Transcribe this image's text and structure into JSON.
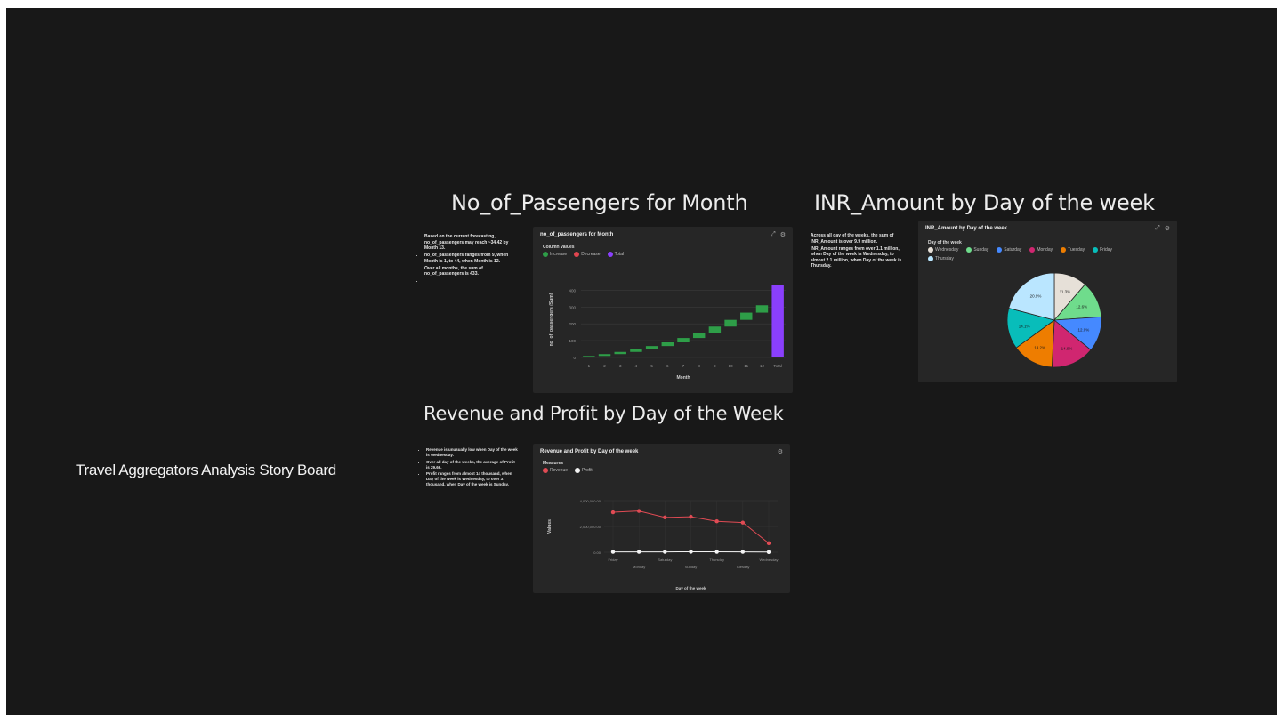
{
  "story": {
    "title": "Travel Aggregators Analysis Story Board"
  },
  "sections": {
    "passengers_title": "No_of_Passengers for Month",
    "inr_title": "INR_Amount by Day of the week",
    "revenue_title": "Revenue and Profit by Day of the Week"
  },
  "passengers_notes": [
    "Based on the current forecasting, no_of_passengers may reach ~34.42 by Month 13.",
    "no_of_passengers ranges from 9, when Month is 1, to 44, when Month is 12.",
    "Over all months, the sum of no_of_passengers is 433."
  ],
  "inr_notes": [
    "Across all day of the weeks, the sum of INR_Amount is over 9.9 million.",
    "INR_Amount ranges from over 1.1 million, when Day of the week is Wednesday, to almost 2.1 million, when Day of the week is Thursday."
  ],
  "revenue_notes": [
    "Revenue is unusually low when Day of the week is Wednesday.",
    "Over all day of the weeks, the average of Profit is 29.66.",
    "Profit ranges from almost 14 thousand, when Day of the week is Wednesday, to over 37 thousand, when Day of the week is Sunday."
  ],
  "passengers_card": {
    "title": "no_of_passengers for Month",
    "legend_title": "Column values",
    "legend": [
      {
        "label": "Increase",
        "color": "#2e9e48"
      },
      {
        "label": "Decrease",
        "color": "#e0454f"
      },
      {
        "label": "Total",
        "color": "#8a3ffc"
      }
    ],
    "icons": [
      "expand-icon",
      "settings-icon"
    ]
  },
  "inr_card": {
    "title": "INR_Amount by Day of the week",
    "legend_title": "Day of the week",
    "icons": [
      "expand-icon",
      "settings-icon"
    ]
  },
  "revenue_card": {
    "title": "Revenue and Profit by Day of the week",
    "legend_title": "Measures",
    "legend": [
      {
        "label": "Revenue",
        "color": "#e04b54"
      },
      {
        "label": "Profit",
        "color": "#f2f2f2"
      }
    ],
    "icons": [
      "settings-icon"
    ]
  },
  "chart_data": [
    {
      "type": "bar",
      "subtype": "waterfall",
      "title": "no_of_passengers for Month",
      "xlabel": "Month",
      "ylabel": "no_of_passengers (Sum)",
      "categories": [
        "1",
        "2",
        "3",
        "4",
        "5",
        "6",
        "7",
        "8",
        "9",
        "10",
        "11",
        "12",
        "Total"
      ],
      "values": [
        9,
        11,
        13,
        16,
        19,
        22,
        26,
        31,
        37,
        40,
        43,
        44,
        433
      ],
      "yticks": [
        "0",
        "100",
        "200",
        "300",
        "400"
      ],
      "ylim": [
        0,
        450
      ],
      "colors": {
        "increase": "#2e9e48",
        "total": "#8a3ffc"
      }
    },
    {
      "type": "pie",
      "title": "INR_Amount by Day of the week",
      "categories": [
        "Wednesday",
        "Sunday",
        "Saturday",
        "Monday",
        "Tuesday",
        "Friday",
        "Thursday"
      ],
      "values": [
        11.3,
        12.6,
        12.0,
        14.9,
        14.2,
        14.1,
        20.9
      ],
      "labels": [
        "11.3%",
        "12.6%",
        "12.0%",
        "14.9%",
        "14.2%",
        "14.1%",
        "20.9%"
      ],
      "colors": [
        "#e6e0d8",
        "#6fdc8c",
        "#4589ff",
        "#d02670",
        "#ee7d00",
        "#08bdba",
        "#bae6ff"
      ]
    },
    {
      "type": "line",
      "title": "Revenue and Profit by Day of the week",
      "xlabel": "Day of the week",
      "ylabel": "Values",
      "categories": [
        "Friday",
        "Monday",
        "Saturday",
        "Sunday",
        "Thursday",
        "Tuesday",
        "Wednesday"
      ],
      "series": [
        {
          "name": "Revenue",
          "values": [
            3100000,
            3200000,
            2700000,
            2750000,
            2400000,
            2300000,
            700000
          ],
          "color": "#e04b54"
        },
        {
          "name": "Profit",
          "values": [
            30000,
            28000,
            29000,
            37000,
            33000,
            30000,
            14000
          ],
          "color": "#f2f2f2"
        }
      ],
      "yticks": [
        "0.00",
        "2,000,000.00",
        "4,000,000.00"
      ],
      "ylim": [
        0,
        4000000
      ],
      "grid": true
    }
  ]
}
